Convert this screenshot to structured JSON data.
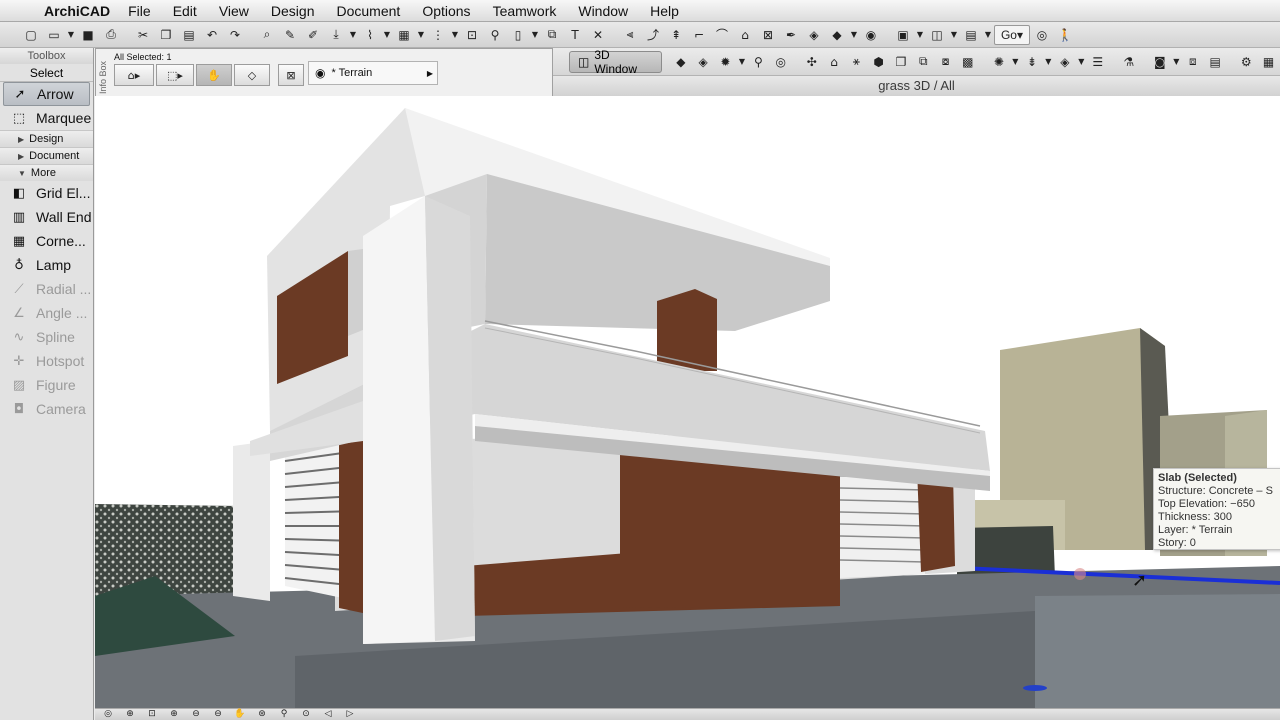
{
  "menubar": {
    "app_name": "ArchiCAD",
    "items": [
      "File",
      "Edit",
      "View",
      "Design",
      "Document",
      "Options",
      "Teamwork",
      "Window",
      "Help"
    ]
  },
  "toolbar1": {
    "go_label": "Go"
  },
  "toolbox": {
    "title": "Toolbox",
    "select_label": "Select",
    "arrow": "Arrow",
    "marquee": "Marquee",
    "groups": {
      "design": "Design",
      "document": "Document",
      "more": "More"
    },
    "tools": [
      {
        "label": "Grid El...",
        "icon": "grid-element-icon",
        "enabled": true
      },
      {
        "label": "Wall End",
        "icon": "wall-end-icon",
        "enabled": true
      },
      {
        "label": "Corne...",
        "icon": "corner-window-icon",
        "enabled": true
      },
      {
        "label": "Lamp",
        "icon": "lamp-icon",
        "enabled": true
      },
      {
        "label": "Radial ...",
        "icon": "radial-dimension-icon",
        "enabled": false
      },
      {
        "label": "Angle ...",
        "icon": "angle-dimension-icon",
        "enabled": false
      },
      {
        "label": "Spline",
        "icon": "spline-icon",
        "enabled": false
      },
      {
        "label": "Hotspot",
        "icon": "hotspot-icon",
        "enabled": false
      },
      {
        "label": "Figure",
        "icon": "figure-icon",
        "enabled": false
      },
      {
        "label": "Camera",
        "icon": "camera-icon",
        "enabled": false
      }
    ]
  },
  "infobox": {
    "side_label": "Info Box",
    "all_selected": "All Selected: 1",
    "layer": "* Terrain"
  },
  "window": {
    "tab_label": "3D Window",
    "title": "grass 3D / All"
  },
  "tooltip": {
    "title": "Slab (Selected)",
    "structure": "Structure: Concrete – S",
    "top_elevation": "Top Elevation: −650",
    "thickness": "Thickness: 300",
    "layer": "Layer: * Terrain",
    "story": "Story: 0"
  },
  "colors": {
    "sky": "#ffffff",
    "walls": "#e4e4e4",
    "wood": "#6b3a24",
    "ground": "#6b7177",
    "selection": "#1a2fd6"
  }
}
